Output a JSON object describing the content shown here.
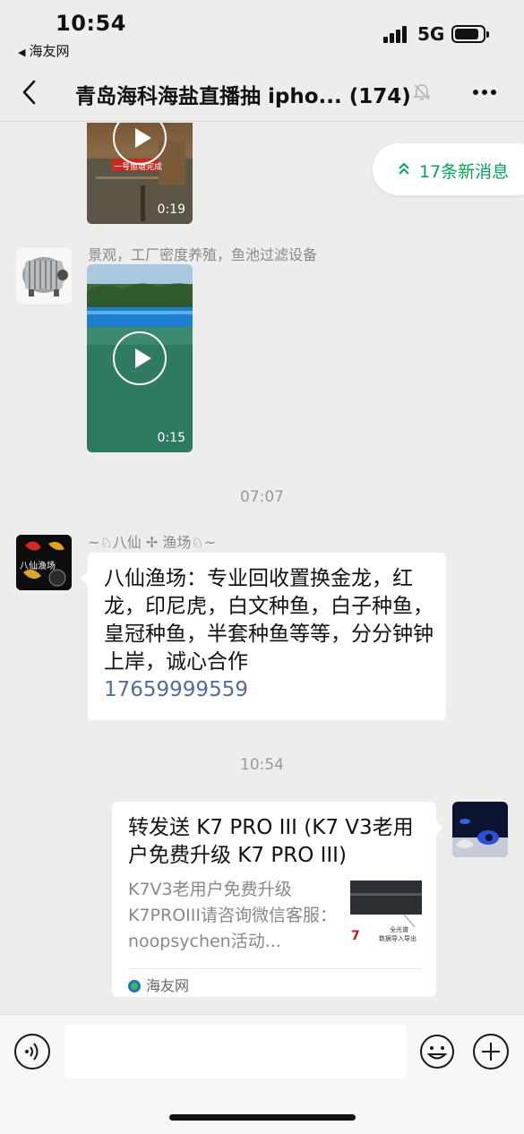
{
  "status_bar": {
    "time": "10:54",
    "back_app": "海友网",
    "network": "5G"
  },
  "nav": {
    "title": "青岛海科海盐直播抽 ipho... (174)"
  },
  "new_messages": {
    "label": "17条新消息"
  },
  "messages": [
    {
      "type": "video",
      "duration": "0:19",
      "banner": "一号鱼塘完成"
    },
    {
      "type": "video",
      "sender": "景观，工厂密度养殖，鱼池过滤设备",
      "duration": "0:15"
    },
    {
      "type": "timestamp",
      "text": "07:07"
    },
    {
      "type": "text",
      "sender": "~♘八仙 ✢ 渔场♘~",
      "avatar_text": "八仙渔场",
      "text": "八仙渔场：专业回收置换金龙，红龙，印尼虎，白文种鱼，白子种鱼，皇冠种鱼，半套种鱼等等，分分钟钟上岸，诚心合作",
      "phone": "17659999559"
    },
    {
      "type": "timestamp",
      "text": "10:54"
    },
    {
      "type": "link_card",
      "title": "转发送 K7 PRO III (K7 V3老用户免费升级 K7 PRO III)",
      "description": "K7V3老用户免费升级K7PROIII请咨询微信客服：noopsychen活动...",
      "thumb_text_1": "7",
      "thumb_text_2": "全光谱",
      "thumb_text_3": "数据导入导出",
      "source": "海友网"
    }
  ],
  "colors": {
    "accent_green": "#07a35a",
    "link_blue": "#576b95",
    "background": "#ededed"
  }
}
